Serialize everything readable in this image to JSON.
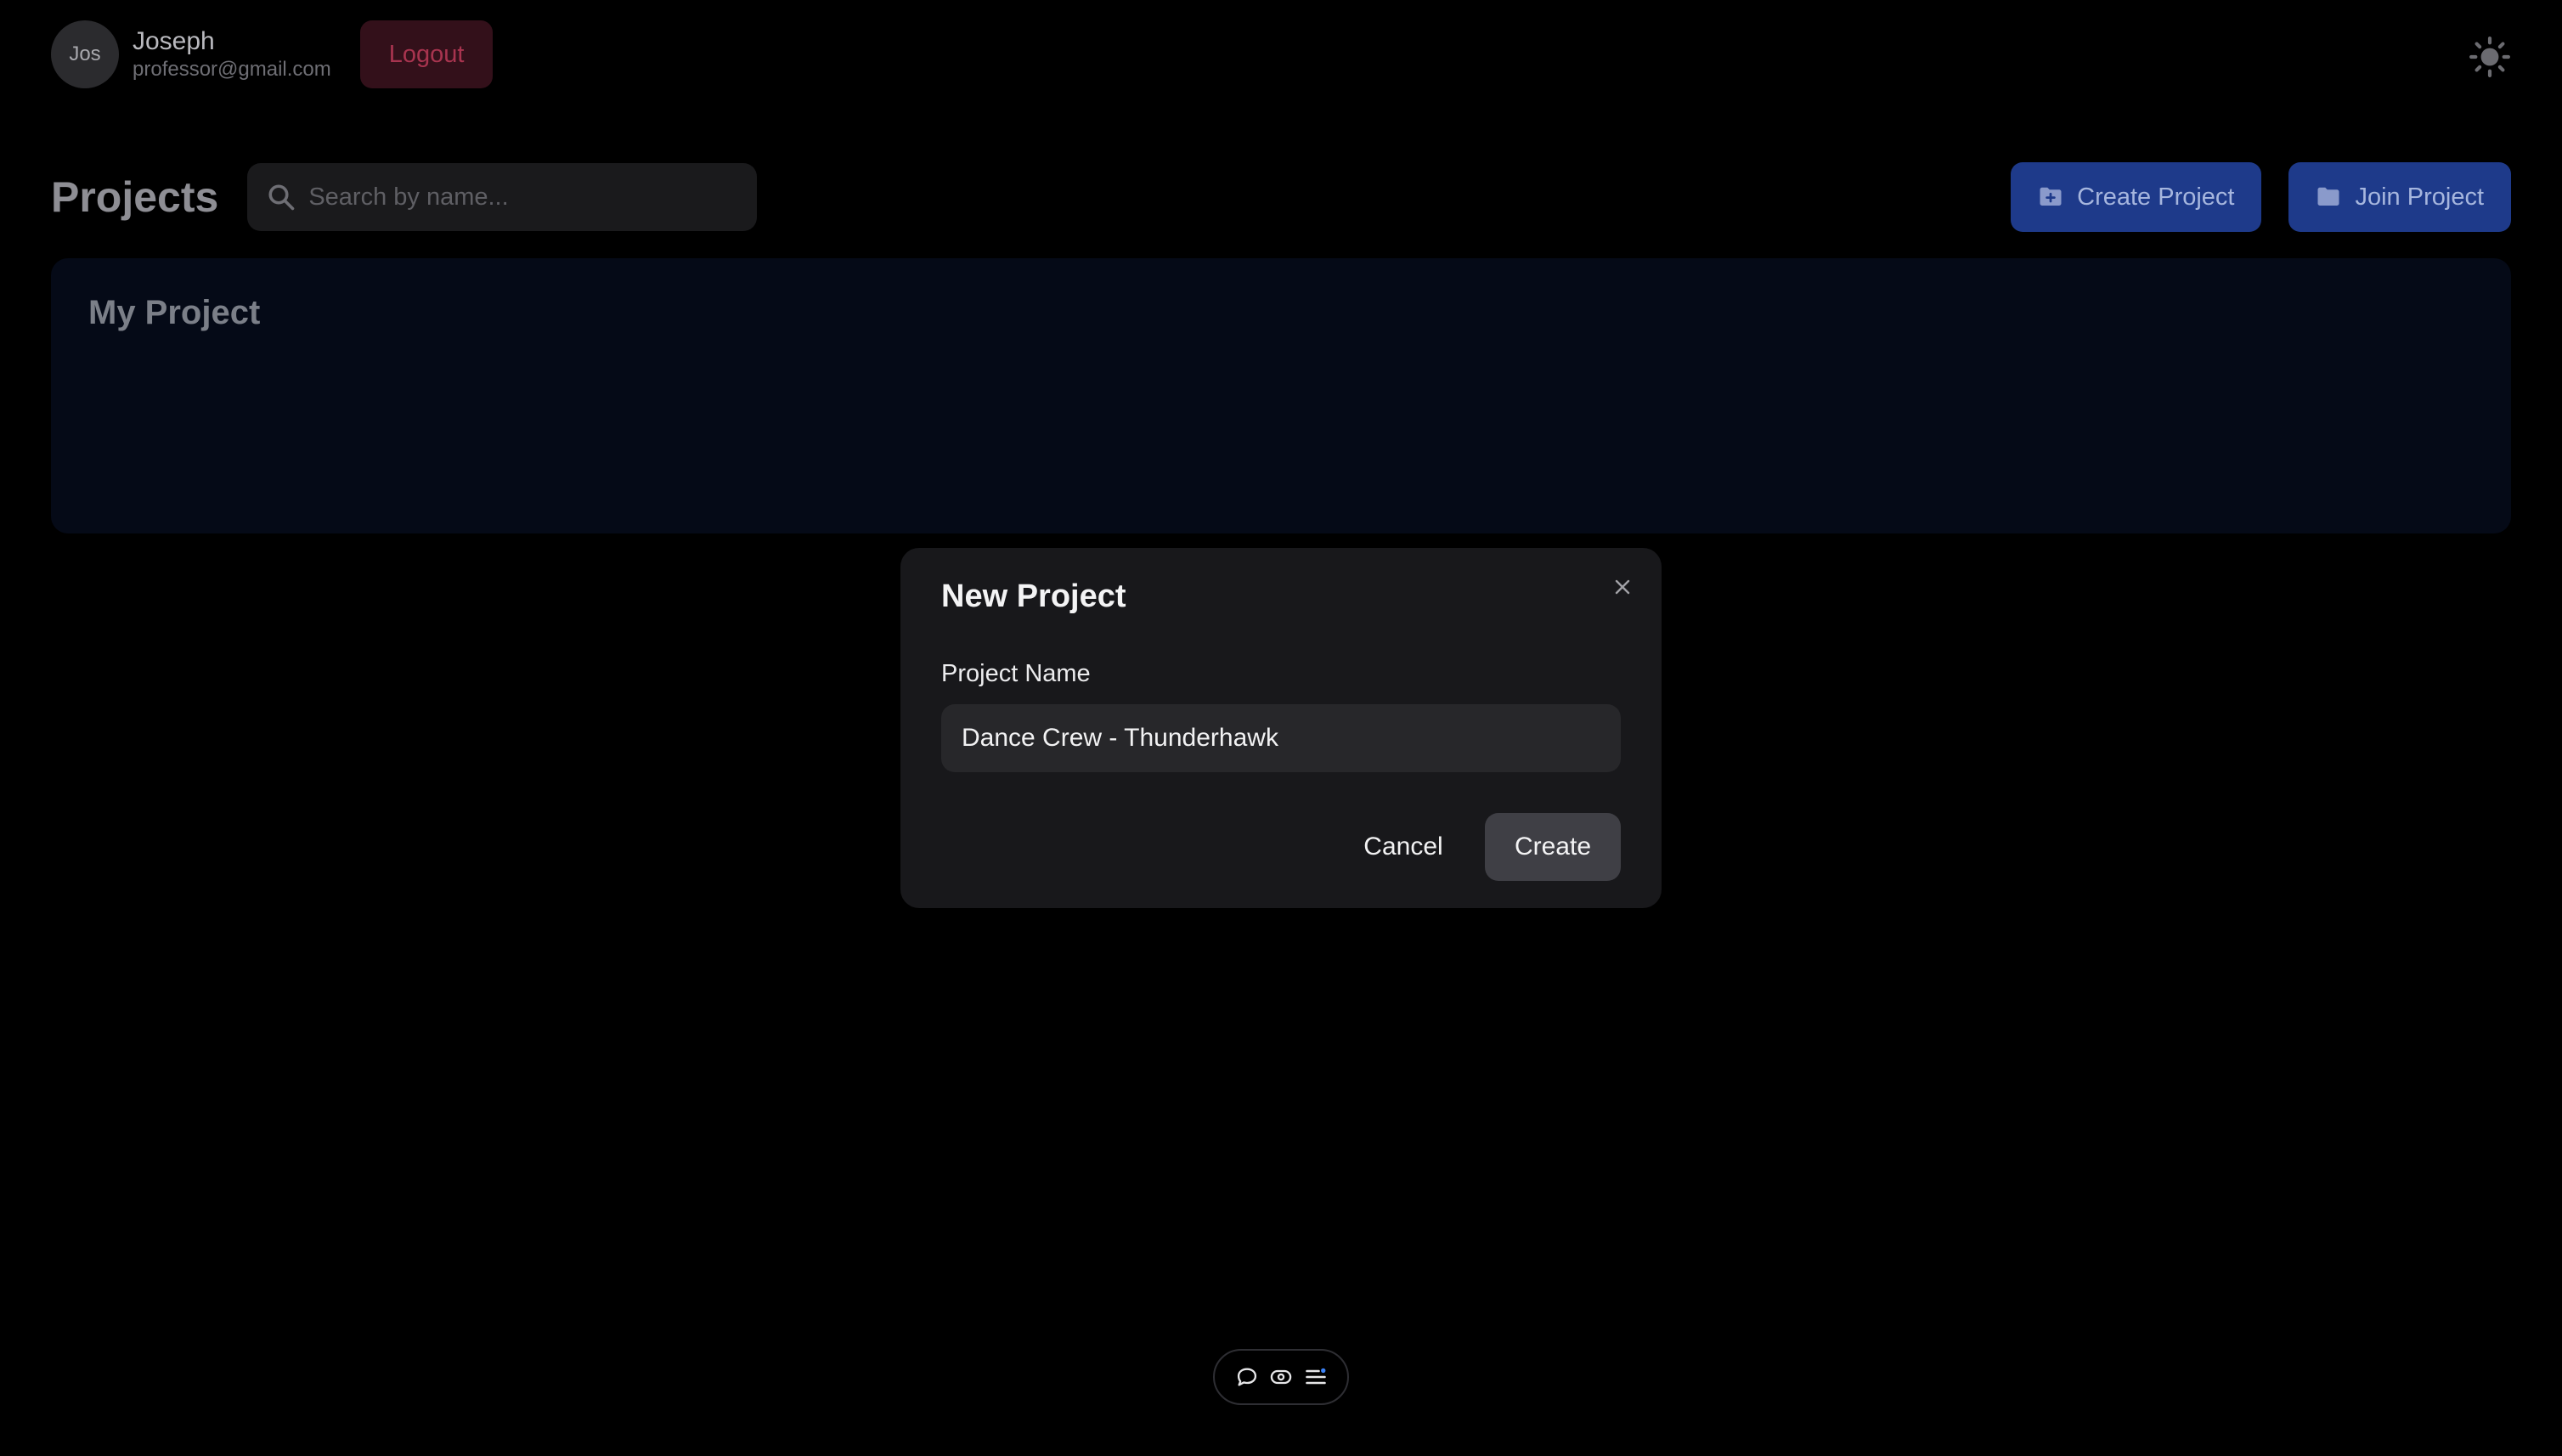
{
  "user": {
    "avatar_initials": "Jos",
    "name": "Joseph",
    "email": "professor@gmail.com",
    "logout_label": "Logout"
  },
  "theme_toggle": {
    "icon": "sun-icon"
  },
  "page": {
    "title": "Projects",
    "search": {
      "placeholder": "Search by name...",
      "value": ""
    },
    "actions": {
      "create_label": "Create Project",
      "join_label": "Join Project"
    }
  },
  "projects_section": {
    "title": "My Project"
  },
  "modal": {
    "title": "New Project",
    "field_label": "Project Name",
    "field_value": "Dance Crew - Thunderhawk",
    "cancel_label": "Cancel",
    "create_label": "Create"
  },
  "floating_toolbar": {
    "icons": [
      "comment-icon",
      "eye-icon",
      "list-icon"
    ]
  },
  "colors": {
    "background": "#000000",
    "accent_button": "#1e3a8a",
    "logout_bg": "#33101a",
    "logout_text": "#a8344f",
    "modal_bg": "#18181b",
    "create_button": "#3f3f45"
  }
}
